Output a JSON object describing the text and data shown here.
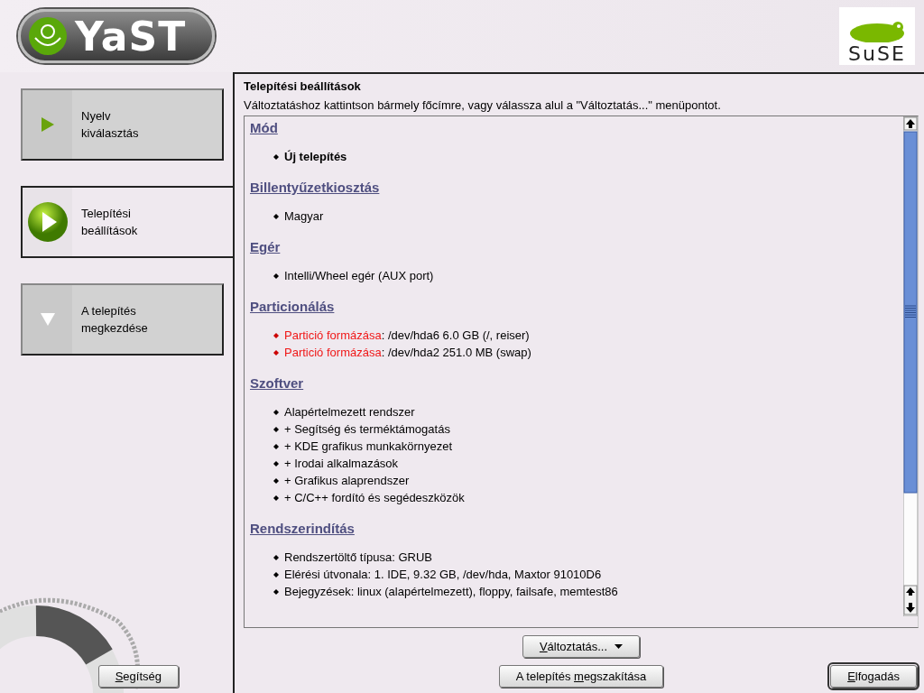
{
  "header": {
    "logo_text": "YaST",
    "brand_text": "SuSE"
  },
  "steps": [
    {
      "label": "Nyelv\nkiválasztás",
      "kind": "done",
      "selected": false
    },
    {
      "label": "Telepítési\nbeállítások",
      "kind": "current",
      "selected": true
    },
    {
      "label": "A telepítés\nmegkezdése",
      "kind": "pending",
      "selected": false
    }
  ],
  "help_button": {
    "key": "S",
    "after": "egítség"
  },
  "panel": {
    "title": "Telepítési beállítások",
    "instruction": "Változtatáshoz kattintson bármely főcímre, vagy válassza alul a \"Változtatás...\" menüpontot.",
    "sections": [
      {
        "heading": "Mód",
        "items": [
          {
            "text": "Új telepítés",
            "bold": true
          }
        ]
      },
      {
        "heading": "Billentyűzetkiosztás",
        "items": [
          {
            "text": "Magyar",
            "bold": false
          }
        ]
      },
      {
        "heading": "Egér",
        "items": [
          {
            "text": "Intelli/Wheel egér (AUX port)",
            "bold": false
          }
        ]
      },
      {
        "heading": "Particionálás",
        "items": [
          {
            "warning": "Partició formázása",
            "text": ": /dev/hda6 6.0 GB (/, reiser)",
            "bold": false
          },
          {
            "warning": "Partició formázása",
            "text": ": /dev/hda2 251.0 MB (swap)",
            "bold": false
          }
        ]
      },
      {
        "heading": "Szoftver",
        "items": [
          {
            "text": "Alapértelmezett rendszer",
            "bold": false
          },
          {
            "text": "+ Segítség és terméktámogatás",
            "bold": false
          },
          {
            "text": "+ KDE grafikus munkakörnyezet",
            "bold": false
          },
          {
            "text": "+ Irodai alkalmazások",
            "bold": false
          },
          {
            "text": "+ Grafikus alaprendszer",
            "bold": false
          },
          {
            "text": "+ C/C++ fordító és segédeszközök",
            "bold": false
          }
        ]
      },
      {
        "heading": "Rendszerindítás",
        "items": [
          {
            "text": "Rendszertöltő típusa: GRUB",
            "bold": false
          },
          {
            "text": "Elérési útvonala: 1. IDE, 9.32 GB, /dev/hda, Maxtor 91010D6",
            "bold": false
          },
          {
            "text": "Bejegyzések: linux (alapértelmezett), floppy, failsafe, memtest86",
            "bold": false
          }
        ]
      }
    ],
    "change_button": {
      "key": "V",
      "after": "áltoztatás..."
    },
    "abort_button": {
      "before": "A telepítés ",
      "key": "m",
      "after": "egszakítása"
    },
    "accept_button": {
      "key": "E",
      "after": "lfogadás"
    }
  }
}
